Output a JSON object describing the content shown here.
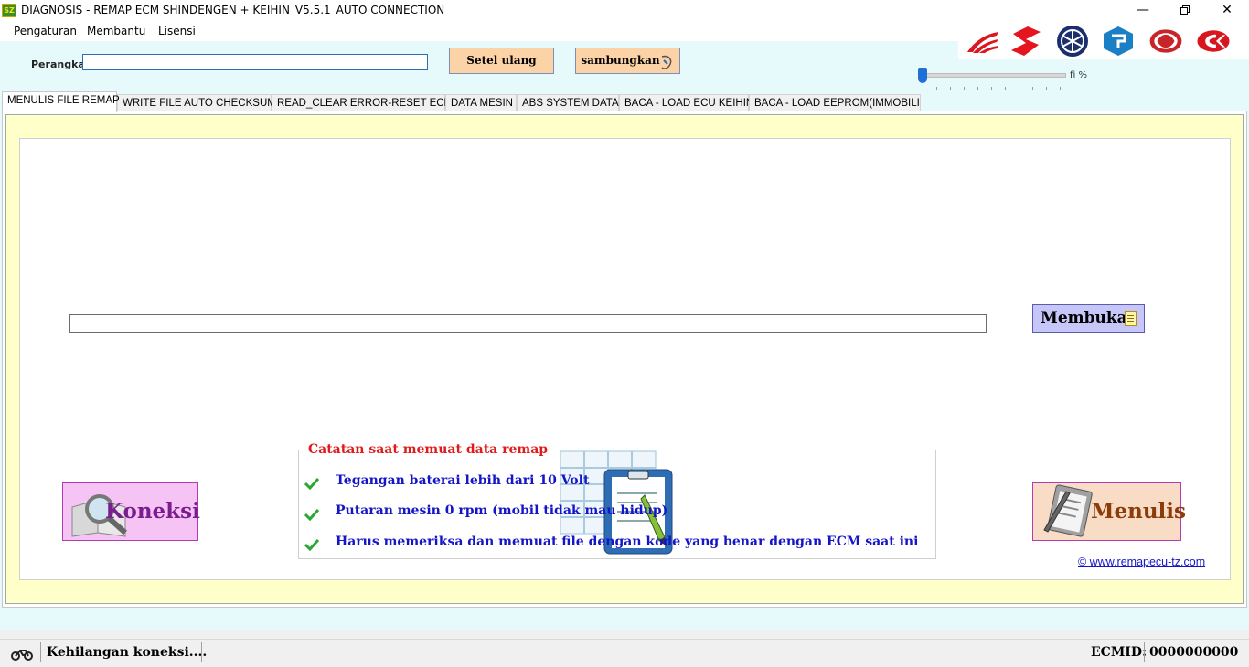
{
  "window": {
    "title": "DIAGNOSIS - REMAP ECM SHINDENGEN + KEIHIN_V5.5.1_AUTO CONNECTION",
    "app_icon_text": "SZ"
  },
  "menubar": {
    "items": [
      "Pengaturan",
      "Membantu",
      "Lisensi"
    ]
  },
  "logos": [
    "honda-wing-logo",
    "suzuki-logo",
    "yamaha-logo",
    "piaggio-logo",
    "daihatsu-logo",
    "kymco-logo"
  ],
  "device": {
    "label": "Perangkat",
    "value": ""
  },
  "buttons": {
    "reset": "Setel ulang",
    "connect_top": "sambungkan",
    "open": "Membuka",
    "connect": "Koneksi",
    "write": "Menulis"
  },
  "slider": {
    "label": "fi %",
    "value_fraction": 0.0
  },
  "tabs": [
    "MENULIS FILE REMAP",
    "WRITE FILE AUTO CHECKSUM",
    "READ_CLEAR ERROR-RESET ECM",
    "DATA MESIN",
    "ABS SYSTEM DATA",
    "BACA - LOAD ECU KEIHIN",
    "BACA - LOAD EEPROM(IMMOBILIZ"
  ],
  "active_tab": 0,
  "file_path": "",
  "notes": {
    "title": "Catatan saat memuat data remap",
    "items": [
      "Tegangan baterai lebih dari 10 Volt",
      "Putaran mesin 0 rpm (mobil tidak mau hidup)",
      "Harus memeriksa dan memuat file dengan kode yang benar dengan ECM saat ini"
    ]
  },
  "website": "© www.remapecu-tz.com",
  "status": {
    "message": "Kehilangan koneksi....",
    "ecmid_label": "ECMID:",
    "ecmid_value": "0000000000"
  },
  "colors": {
    "accent_blue": "#1515c8",
    "note_title_red": "#e01b1b",
    "panel_yellow": "#ffffc9",
    "app_bg": "#e6fafc"
  }
}
